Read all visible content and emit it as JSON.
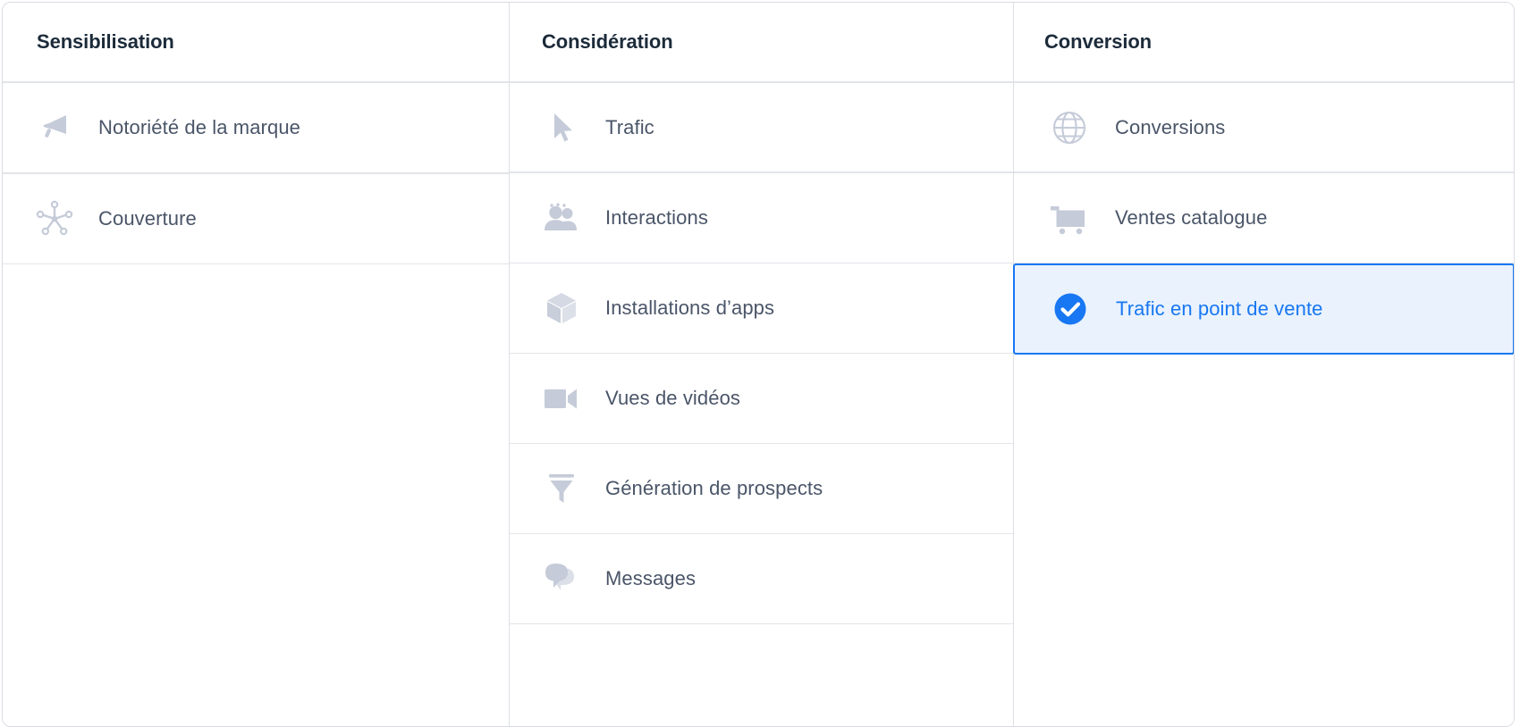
{
  "picker": {
    "columns": [
      {
        "id": "sensibilisation",
        "title": "Sensibilisation",
        "items": [
          {
            "label": "Notoriété de la marque",
            "icon": "megaphone-icon",
            "selected": false
          },
          {
            "label": "Couverture",
            "icon": "reach-starburst-icon",
            "selected": false
          }
        ]
      },
      {
        "id": "consideration",
        "title": "Considération",
        "items": [
          {
            "label": "Trafic",
            "icon": "cursor-arrow-icon",
            "selected": false
          },
          {
            "label": "Interactions",
            "icon": "people-group-icon",
            "selected": false
          },
          {
            "label": "Installations d’apps",
            "icon": "cube-box-icon",
            "selected": false
          },
          {
            "label": "Vues de vidéos",
            "icon": "video-camera-icon",
            "selected": false
          },
          {
            "label": "Génération de prospects",
            "icon": "funnel-icon",
            "selected": false
          },
          {
            "label": "Messages",
            "icon": "chat-bubbles-icon",
            "selected": false
          }
        ]
      },
      {
        "id": "conversion",
        "title": "Conversion",
        "items": [
          {
            "label": "Conversions",
            "icon": "globe-icon",
            "selected": false
          },
          {
            "label": "Ventes catalogue",
            "icon": "shopping-cart-icon",
            "selected": false
          },
          {
            "label": "Trafic en point de vente",
            "icon": "check-circle-icon",
            "selected": true
          }
        ]
      }
    ]
  },
  "colors": {
    "accent": "#1877f2",
    "selected_background": "#e9f2fd",
    "icon_gray": "#c5cbd8",
    "label_text": "#4a5568",
    "header_text": "#1c2b3a",
    "border": "#e3e5ea",
    "card_border": "#d9dce3"
  }
}
